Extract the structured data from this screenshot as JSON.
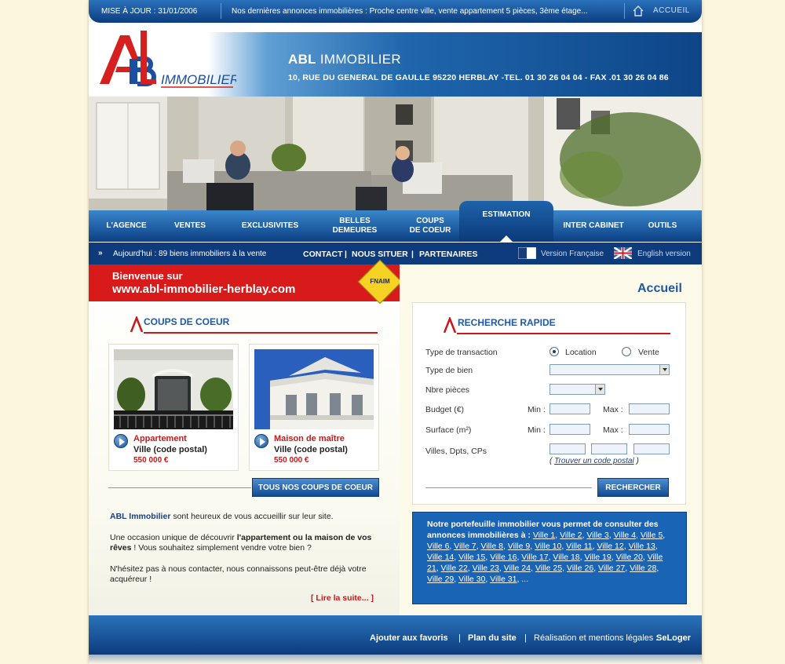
{
  "topbar": {
    "update_label": "MISE À JOUR : 31/01/2006",
    "news": "Nos dernières annonces immobilières : Proche centre ville, vente appartement 5 pièces, 3ème étage...",
    "home_label": "ACCUEIL"
  },
  "header": {
    "logo_letters": "ABL",
    "logo_word": "IMMOBILIER",
    "agency_bold": "ABL",
    "agency_rest": " IMMOBILIER",
    "address": "10, RUE DU GENERAL DE GAULLE 95220 HERBLAY -TEL. 01 30 26 04 04 - FAX .01 30 26 04 86"
  },
  "nav": {
    "items": [
      {
        "line1": "L'AGENCE",
        "line2": ""
      },
      {
        "line1": "VENTES",
        "line2": ""
      },
      {
        "line1": "EXCLUSIVITES",
        "line2": ""
      },
      {
        "line1": "BELLES",
        "line2": "DEMEURES"
      },
      {
        "line1": "COUPS",
        "line2": "DE COEUR"
      },
      {
        "line1": "ESTIMATION",
        "line2": ""
      },
      {
        "line1": "INTER CABINET",
        "line2": ""
      },
      {
        "line1": "OUTILS",
        "line2": ""
      }
    ],
    "active": "ESTIMATION"
  },
  "subnav": {
    "today": "Aujourd'hui : 89 biens immobiliers à la vente",
    "contact": "CONTACT",
    "situer": "NOUS SITUER",
    "partenaires": "PARTENAIRES",
    "separator": "|",
    "lang_fr": "Version Française",
    "lang_en": "English version"
  },
  "welcome": {
    "line1": "Bienvenue sur",
    "line2": "www.abl-immobilier-herblay.com",
    "badge": "FNAIM"
  },
  "coups": {
    "title": "COUPS DE COEUR",
    "cards": [
      {
        "type": "Appartement",
        "ville": "Ville (code postal)",
        "price": "550 000 €"
      },
      {
        "type": "Maison de maître",
        "ville": "Ville (code postal)",
        "price": "550 000 €"
      }
    ],
    "all_button": "TOUS NOS COUPS DE COEUR"
  },
  "intro": {
    "p1_bold": "ABL Immobilier",
    "p1_rest": " sont heureux de vous accueillir sur leur site.",
    "p2_start": "Une occasion unique de découvrir ",
    "p2_bold": "l'appartement ou la maison de vos rêves",
    "p2_end": " ! Vous souhaitez simplement vendre votre bien ?",
    "p3": "N'hésitez pas à nous contacter, nous connaissons peut-être déjà votre acquéreur !",
    "read_more": "[ Lire la suite... ]"
  },
  "right": {
    "page_title": "Accueil",
    "search_title": "RECHERCHE RAPIDE",
    "labels": {
      "transaction": "Type de transaction",
      "bien": "Type de bien",
      "pieces": "Nbre pièces",
      "budget": "Budget (€)",
      "surface": "Surface (m²)",
      "villes": "Villes, Dpts, CPs",
      "min": "Min :",
      "max": "Max :"
    },
    "radio_location": "Location",
    "radio_vente": "Vente",
    "selected_transaction": "Location",
    "find_cp_open": "(",
    "find_cp": "Trouver un code postal",
    "find_cp_close": ")",
    "search_button": "RECHERCHER"
  },
  "portfolio": {
    "intro": "Notre portefeuille immobilier vous permet de consulter des annonces immobilières à :",
    "villes": [
      "Ville 1",
      "Ville 2",
      "Ville 3",
      "Ville 4",
      "Ville 5",
      "Ville 6",
      "Ville 7",
      "Ville 8",
      "Ville 9",
      "Ville 10",
      "Ville 11",
      "Ville 12",
      "Ville 13",
      "Ville 14",
      "Ville 15",
      "Ville 16",
      "Ville 17",
      "Ville 18",
      "Ville 19",
      "Ville 20",
      "Ville 21",
      "Ville 22",
      "Ville 23",
      "Ville 24",
      "Ville 25",
      "Ville 26",
      "Ville 27",
      "Ville 28",
      "Ville 29",
      "Ville 30",
      "Ville 31"
    ],
    "ellipsis": "..."
  },
  "footer": {
    "favoris": "Ajouter aux favoris",
    "plan": "Plan du site",
    "legal": "Réalisation et mentions légales :",
    "seloger": "SeLoger",
    "separator": "|"
  },
  "colors": {
    "brand_blue": "#0d3b7c",
    "accent_red": "#c9181a",
    "page_bg": "#fbf6de"
  }
}
